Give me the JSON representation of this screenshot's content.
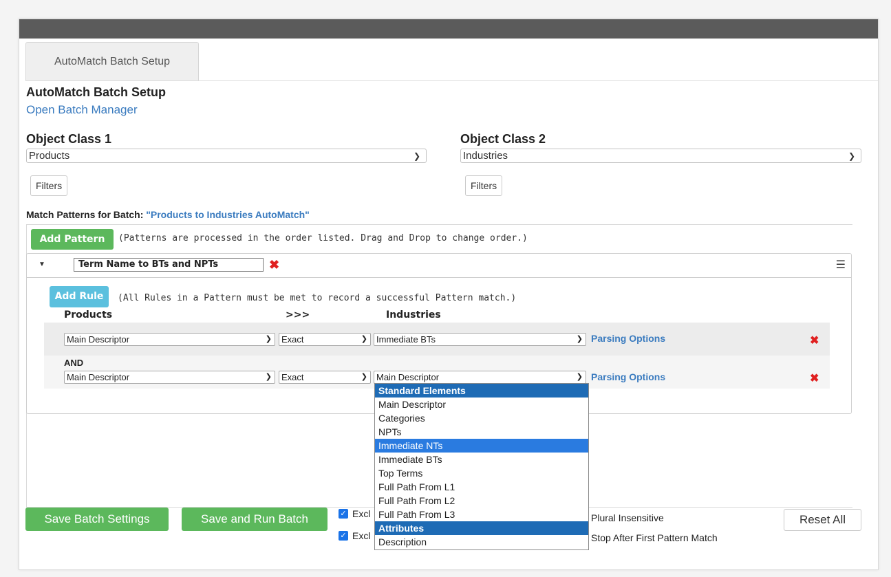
{
  "tab": {
    "label": "AutoMatch Batch Setup"
  },
  "page": {
    "title": "AutoMatch Batch Setup",
    "open_batch_manager": "Open Batch Manager"
  },
  "object_class_1": {
    "label": "Object Class 1",
    "selected": "Products",
    "filters_label": "Filters"
  },
  "object_class_2": {
    "label": "Object Class 2",
    "selected": "Industries",
    "filters_label": "Filters"
  },
  "match_patterns": {
    "label": "Match Patterns for Batch:",
    "batch_name": "\"Products to Industries AutoMatch\"",
    "add_pattern_label": "Add Pattern",
    "hint": "(Patterns are processed in the order listed. Drag and Drop to change order.)"
  },
  "pattern": {
    "name": "Term Name to BTs and NPTs",
    "add_rule_label": "Add Rule",
    "rule_hint": "(All Rules in a Pattern must be met to record a successful Pattern match.)",
    "col_left": "Products",
    "col_mid": ">>>",
    "col_right": "Industries",
    "and_label": "AND",
    "rules": [
      {
        "left": "Main Descriptor",
        "operator": "Exact",
        "right": "Immediate BTs",
        "parsing": "Parsing Options"
      },
      {
        "left": "Main Descriptor",
        "operator": "Exact",
        "right": "Main Descriptor",
        "parsing": "Parsing Options"
      }
    ]
  },
  "dropdown": {
    "options": [
      {
        "label": "Standard Elements",
        "kind": "group"
      },
      {
        "label": "Main Descriptor",
        "kind": "item"
      },
      {
        "label": "Categories",
        "kind": "item"
      },
      {
        "label": "NPTs",
        "kind": "item"
      },
      {
        "label": "Immediate NTs",
        "kind": "highlight"
      },
      {
        "label": "Immediate BTs",
        "kind": "item"
      },
      {
        "label": "Top Terms",
        "kind": "item"
      },
      {
        "label": "Full Path From L1",
        "kind": "item"
      },
      {
        "label": "Full Path From L2",
        "kind": "item"
      },
      {
        "label": "Full Path From L3",
        "kind": "item"
      },
      {
        "label": "Attributes",
        "kind": "group"
      },
      {
        "label": "Description",
        "kind": "item"
      }
    ]
  },
  "footer": {
    "save_settings": "Save Batch Settings",
    "save_run": "Save and Run Batch",
    "opt1_partial": "Excl",
    "opt2_partial": "Excl",
    "plural": "Plural Insensitive",
    "stop_after": "Stop After First Pattern Match",
    "reset_all": "Reset All"
  },
  "colors": {
    "accent": "#3a7bbf",
    "green": "#5cb85c",
    "info": "#5bc0de",
    "danger": "#e02020",
    "topbar": "#5b5b5b"
  }
}
